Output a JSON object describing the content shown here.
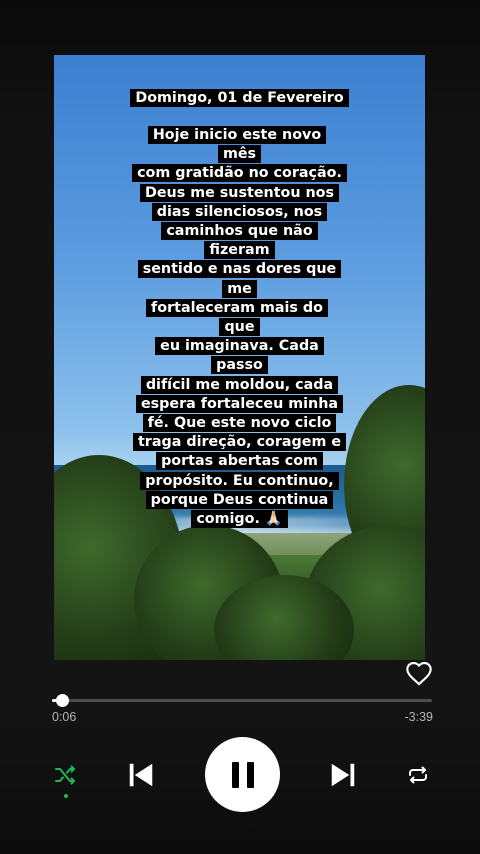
{
  "story": {
    "date": "Domingo, 01 de Fevereiro",
    "lines": [
      "Hoje inicio este novo mês",
      "com gratidão no coração.",
      "Deus me sustentou nos",
      "dias silenciosos, nos",
      "caminhos que não fizeram",
      "sentido e nas dores que me",
      "fortaleceram mais do que",
      "eu imaginava. Cada passo",
      "difícil me moldou, cada",
      "espera fortaleceu minha",
      "fé. Que este novo ciclo",
      "traga direção, coragem e",
      "portas abertas com",
      "propósito. Eu continuo,",
      "porque Deus continua",
      "comigo. 🙏🏻"
    ]
  },
  "player": {
    "elapsed": "0:06",
    "remaining": "-3:39",
    "progress_fraction": 0.027,
    "is_playing": true,
    "shuffle_on": true,
    "accent_color": "#1db954"
  },
  "icons": {
    "like": "heart-outline-icon",
    "shuffle": "shuffle-icon",
    "previous": "skip-previous-icon",
    "pause": "pause-icon",
    "next": "skip-next-icon",
    "repeat": "repeat-icon"
  }
}
